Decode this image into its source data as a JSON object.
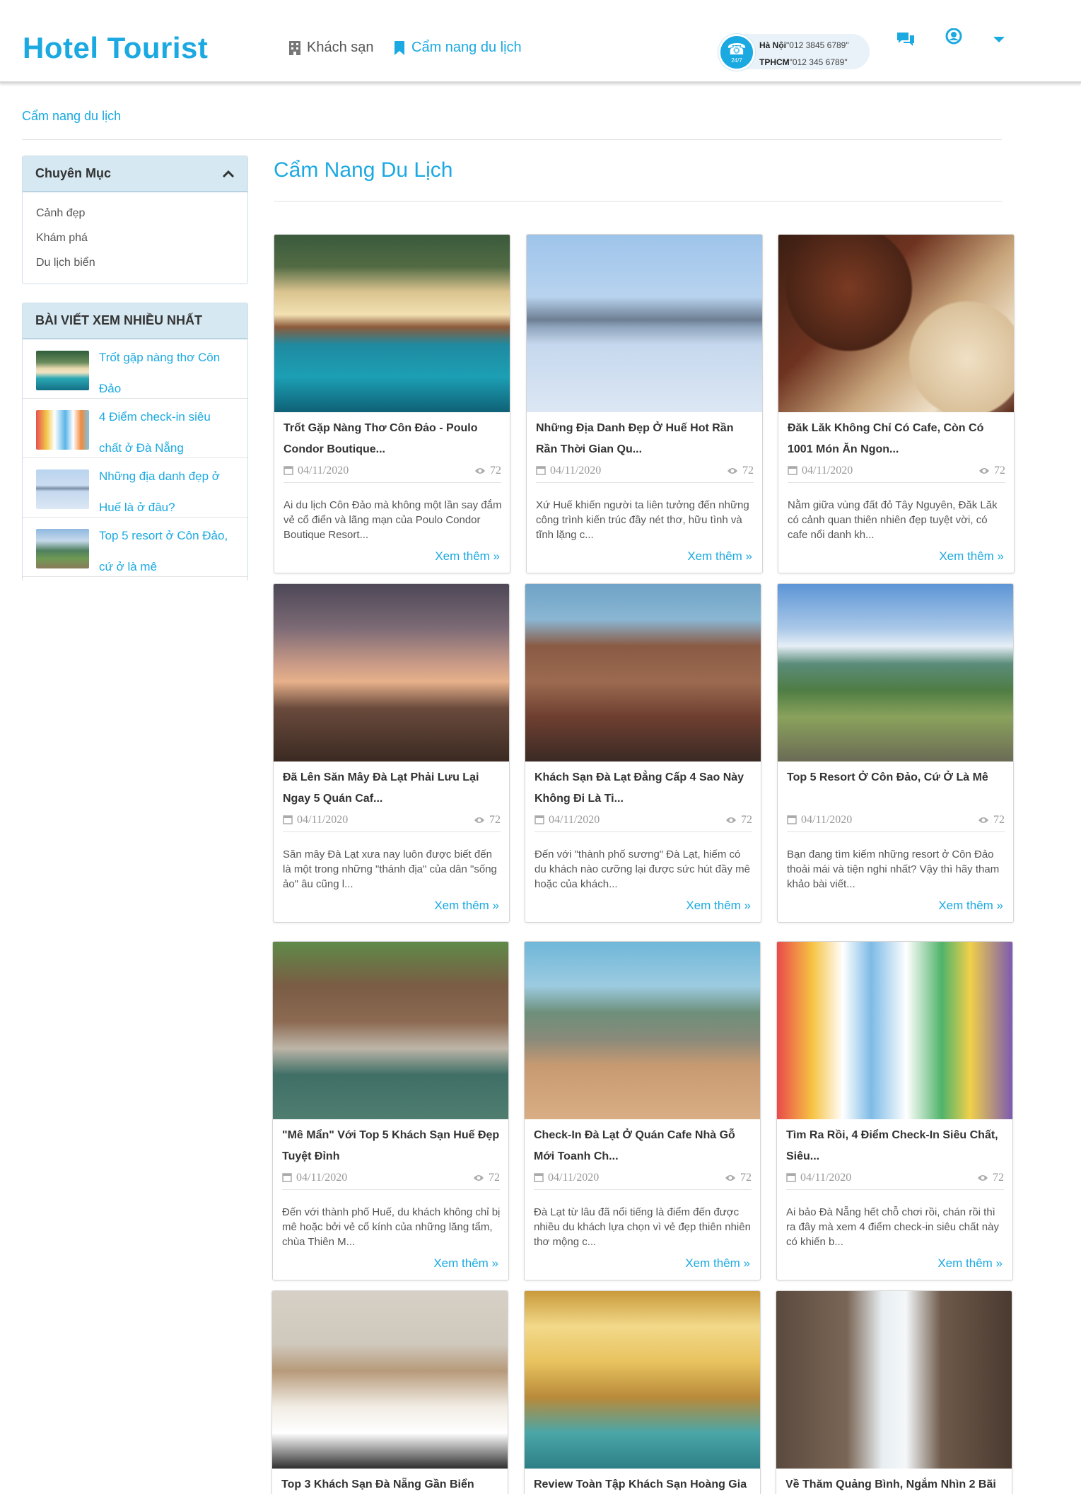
{
  "header": {
    "logo": "Hotel Tourist",
    "nav": [
      {
        "label": "Khách sạn",
        "icon": "building-icon"
      },
      {
        "label": "Cẩm nang du lịch",
        "icon": "bookmark-icon"
      }
    ],
    "hotline": {
      "badge": "24/7",
      "hanoi_label": "Hà Nội",
      "hanoi_phone": "\"012 3845 6789\"",
      "hcm_label": "TPHCM",
      "hcm_phone": "\"012 345 6789\""
    },
    "icons": [
      "chat-icon",
      "user-icon",
      "caret-down-icon"
    ]
  },
  "breadcrumb": "Cẩm nang du lịch",
  "sidebar": {
    "categories_title": "Chuyên Mục",
    "categories": [
      "Cảnh đẹp",
      "Khám phá",
      "Du lịch biển"
    ],
    "popular_title": "BÀI VIẾT XEM NHIỀU NHẤT",
    "popular": [
      {
        "title": "Trốt gặp nàng thơ Côn Đảo"
      },
      {
        "title": "4 Điểm check-in siêu chất ở Đà Nẵng"
      },
      {
        "title": "Những địa danh đẹp ở Huế là ở đâu?"
      },
      {
        "title": "Top 5 resort ở Côn Đảo, cứ ở là mê"
      }
    ]
  },
  "main": {
    "title": "Cẩm Nang Du Lịch",
    "more_label": "Xem thêm »",
    "cards": [
      {
        "title": "Trốt Gặp Nàng Thơ Côn Đảo - Poulo Condor Boutique...",
        "date": "04/11/2020",
        "views": "72",
        "desc": "Ai du lịch Côn Đảo mà không một lần say đắm vẻ cổ điển và lãng mạn của Poulo Condor Boutique Resort..."
      },
      {
        "title": "Những Địa Danh Đẹp Ở Huế Hot Rần Rần Thời Gian Qu...",
        "date": "04/11/2020",
        "views": "72",
        "desc": "Xứ Huế khiến người ta liên tưởng đến những công trình kiến trúc đầy nét thơ, hữu tình và tĩnh lặng c..."
      },
      {
        "title": "Đăk Lăk Không Chỉ Có Cafe, Còn Có 1001 Món Ăn Ngon...",
        "date": "04/11/2020",
        "views": "72",
        "desc": "Nằm giữa vùng đất đỏ Tây Nguyên, Đăk Lăk có cảnh quan thiên nhiên đẹp tuyệt vời, có cafe nổi danh kh..."
      },
      {
        "title": "Đã Lên Săn Mây Đà Lạt Phải Lưu Lại Ngay 5 Quán Caf...",
        "date": "04/11/2020",
        "views": "72",
        "desc": "Săn mây Đà Lạt xưa nay luôn được biết đến là một trong những \"thánh địa\" của dân \"sống ảo\" âu cũng l..."
      },
      {
        "title": "Khách Sạn Đà Lạt Đẳng Cấp 4 Sao Này Không Đi Là Ti...",
        "date": "04/11/2020",
        "views": "72",
        "desc": "Đến với \"thành phố sương\" Đà Lạt, hiếm có du khách nào cưỡng lại được sức hút đầy mê hoặc của khách..."
      },
      {
        "title": "Top 5 Resort Ở Côn Đảo, Cứ Ở Là Mê",
        "date": "04/11/2020",
        "views": "72",
        "desc": "Bạn đang tìm kiếm những resort ở Côn Đảo thoải mái và tiện nghi nhất? Vậy thì hãy tham khảo bài viết..."
      },
      {
        "title": "\"Mê Mẩn\" Với Top 5 Khách Sạn Huế Đẹp Tuyệt Đỉnh",
        "date": "04/11/2020",
        "views": "72",
        "desc": "Đến với thành phố Huế, du khách không chỉ bị mê hoặc bởi vẻ cổ kính của những lăng tẩm, chùa Thiên M..."
      },
      {
        "title": "Check-In Đà Lạt Ở Quán Cafe Nhà Gỗ Mới Toanh Ch...",
        "date": "04/11/2020",
        "views": "72",
        "desc": "Đà Lạt từ lâu đã nổi tiếng là điểm đến được nhiều du khách lựa chọn vì vẻ đẹp thiên nhiên thơ mộng c..."
      },
      {
        "title": "Tìm Ra Rồi, 4 Điểm Check-In Siêu Chất, Siêu...",
        "date": "04/11/2020",
        "views": "72",
        "desc": "Ai bảo Đà Nẵng hết chỗ chơi rồi, chán rồi thì ra đây mà xem 4 điểm check-in siêu chất này có khiến b..."
      },
      {
        "title": "Top 3 Khách Sạn Đà Nẵng Gần Biển",
        "date": "",
        "views": "",
        "desc": ""
      },
      {
        "title": "Review Toàn Tập Khách Sạn Hoàng Gia",
        "date": "",
        "views": "",
        "desc": ""
      },
      {
        "title": "Về Thăm Quảng Bình, Ngắm Nhìn 2 Bãi",
        "date": "",
        "views": "",
        "desc": ""
      }
    ]
  },
  "colors": {
    "accent": "#1ba9e1",
    "panel_head": "#d6e8f2"
  }
}
